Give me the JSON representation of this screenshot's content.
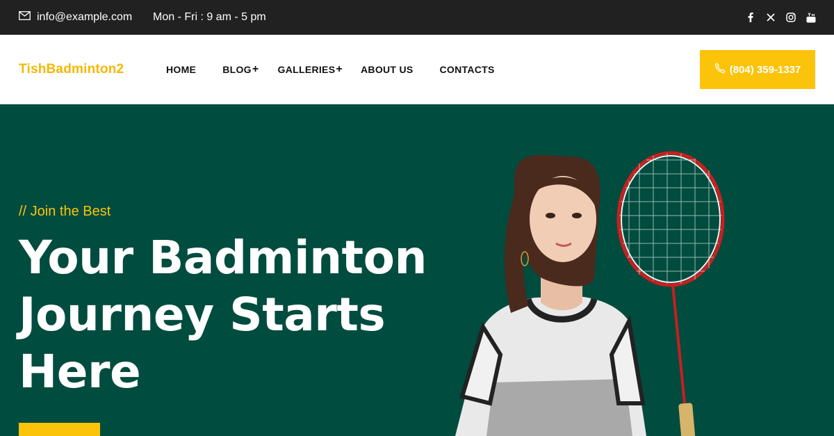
{
  "topbar": {
    "email": "info@example.com",
    "hours": "Mon - Fri : 9 am - 5 pm",
    "social": [
      "facebook-icon",
      "x-icon",
      "instagram-icon",
      "youtube-icon"
    ]
  },
  "header": {
    "logo": "TishBadminton2",
    "nav": {
      "home": "HOME",
      "blog": "BLOG",
      "galleries": "GALLERIES",
      "about": "ABOUT US",
      "contacts": "CONTACTS",
      "submenu_indicator": "+"
    },
    "phone": "(804) 359-1337"
  },
  "hero": {
    "tagline": "// Join the Best",
    "headline_line1": "Your Badminton",
    "headline_line2": "Journey Starts",
    "headline_line3": "Here"
  },
  "colors": {
    "accent": "#fcc30b",
    "hero_bg": "#004c3f",
    "topbar_bg": "#212121"
  }
}
